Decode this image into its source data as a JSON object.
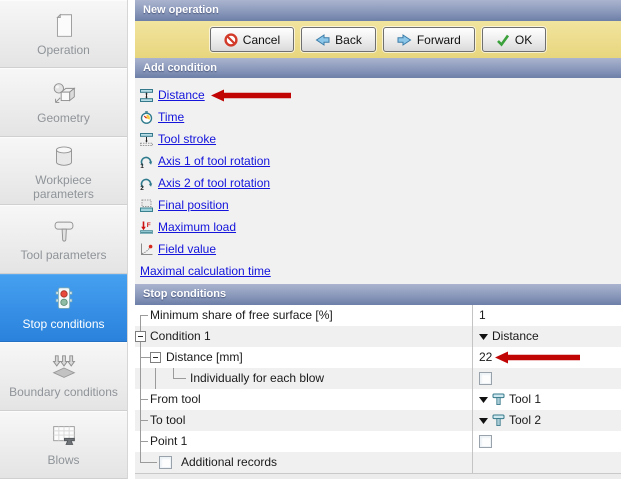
{
  "window": {
    "title": "New operation"
  },
  "sidebar": {
    "items": [
      {
        "label": "Operation",
        "icon": "operation-icon",
        "selected": false
      },
      {
        "label": "Geometry",
        "icon": "geometry-icon",
        "selected": false
      },
      {
        "label": "Workpiece parameters",
        "icon": "workpiece-icon",
        "selected": false
      },
      {
        "label": "Tool parameters",
        "icon": "tool-params-icon",
        "selected": false
      },
      {
        "label": "Stop conditions",
        "icon": "traffic-light-icon",
        "selected": true
      },
      {
        "label": "Boundary conditions",
        "icon": "boundary-icon",
        "selected": false
      },
      {
        "label": "Blows",
        "icon": "blows-icon",
        "selected": false
      }
    ]
  },
  "toolbar": {
    "buttons": [
      {
        "label": "Cancel",
        "icon": "cancel-icon"
      },
      {
        "label": "Back",
        "icon": "back-arrow-icon"
      },
      {
        "label": "Forward",
        "icon": "forward-arrow-icon"
      },
      {
        "label": "OK",
        "icon": "ok-check-icon"
      }
    ]
  },
  "add_condition": {
    "title": "Add condition",
    "links": [
      {
        "label": "Distance",
        "icon": "distance-icon"
      },
      {
        "label": "Time",
        "icon": "time-icon"
      },
      {
        "label": "Tool stroke",
        "icon": "tool-stroke-icon"
      },
      {
        "label": "Axis 1 of tool rotation",
        "icon": "axis1-rotation-icon"
      },
      {
        "label": "Axis 2 of tool rotation",
        "icon": "axis2-rotation-icon"
      },
      {
        "label": "Final position",
        "icon": "final-position-icon"
      },
      {
        "label": "Maximum load",
        "icon": "maximum-load-icon"
      },
      {
        "label": "Field value",
        "icon": "field-value-icon"
      },
      {
        "label": "Maximal calculation time",
        "icon": ""
      }
    ]
  },
  "stop_conditions": {
    "title": "Stop conditions",
    "rows": [
      {
        "label": "Minimum share of free surface [%]",
        "value": "1",
        "control": "text"
      },
      {
        "label": "Condition 1",
        "value": "Distance",
        "control": "dropdown"
      },
      {
        "label": "Distance [mm]",
        "value": "22",
        "control": "text"
      },
      {
        "label": "Individually for each blow",
        "value": "",
        "control": "checkbox-unchecked"
      },
      {
        "label": "From tool",
        "value": "Tool 1",
        "control": "dropdown-tool"
      },
      {
        "label": "To tool",
        "value": "Tool 2",
        "control": "dropdown-tool"
      },
      {
        "label": "Point 1",
        "value": "",
        "control": "checkbox-unchecked"
      },
      {
        "label": "Additional records",
        "value": "",
        "control": "label-checkbox-unchecked"
      }
    ]
  },
  "annotations": {
    "arrow_count": 2,
    "arrow_color": "#c10505",
    "arrow_targets": [
      "Distance link",
      "Distance [mm] value 22"
    ]
  },
  "colors": {
    "selected_blue": "#2f8be0",
    "header_gradient_top": "#aab4ce",
    "header_gradient_bottom": "#6d7fa8",
    "toolbar_yellow": "#ecdf92",
    "link_blue": "#1414dc",
    "row_alt": "#f0f0f0",
    "teal_icon": "#33798b"
  }
}
